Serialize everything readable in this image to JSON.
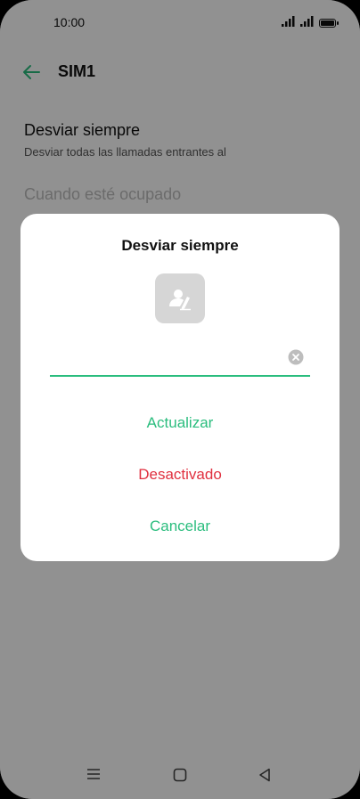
{
  "status_bar": {
    "time": "10:00"
  },
  "header": {
    "title": "SIM1"
  },
  "content": {
    "item1_title": "Desviar siempre",
    "item1_subtitle": "Desviar todas las llamadas entrantes al",
    "item2_title": "Cuando esté ocupado"
  },
  "dialog": {
    "title": "Desviar siempre",
    "input_value": "",
    "actions": {
      "update": "Actualizar",
      "deactivate": "Desactivado",
      "cancel": "Cancelar"
    }
  },
  "colors": {
    "accent": "#2bbd7e",
    "danger": "#e0303f",
    "scrim": "#000000"
  },
  "icons": {
    "back": "arrow-left",
    "contact": "contact-edit",
    "clear": "clear-circle",
    "nav_menu": "menu-lines",
    "nav_home": "square",
    "nav_back": "triangle-left"
  }
}
